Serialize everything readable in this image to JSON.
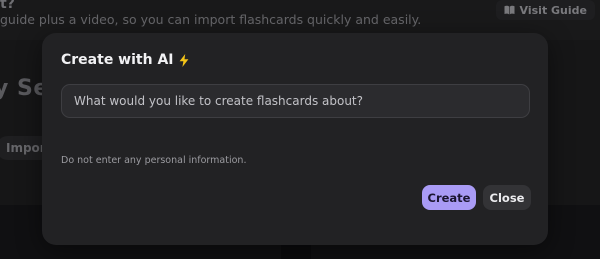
{
  "background": {
    "heading_fragment": "t?",
    "subtext": "guide plus a video, so you can import flashcards quickly and easily.",
    "visit_guide_label": "Visit Guide",
    "title_fragment": "y Set",
    "import_chip_label": "Impor"
  },
  "modal": {
    "title": "Create with AI",
    "title_icon": "lightning-bolt-icon",
    "input": {
      "value": "",
      "placeholder": "What would you like to create flashcards about?"
    },
    "privacy_note": "Do not enter any personal information.",
    "create_label": "Create",
    "close_label": "Close"
  },
  "colors": {
    "accent": "#a99bf5",
    "modal_bg": "#222224",
    "page_bg": "#1c1c1e"
  }
}
